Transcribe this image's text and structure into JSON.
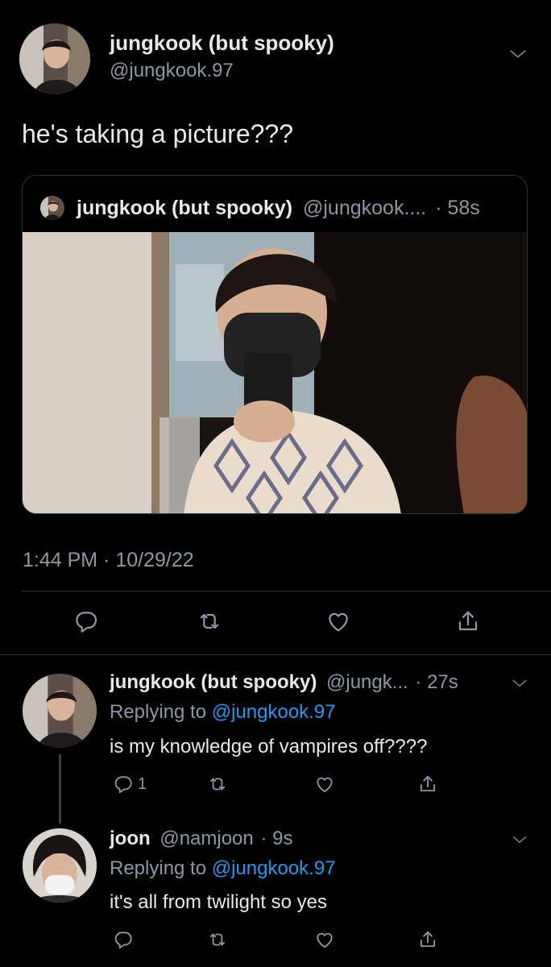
{
  "main_tweet": {
    "display_name": "jungkook (but spooky)",
    "handle": "@jungkook.97",
    "text": "he's taking a picture???",
    "timestamp": "1:44 PM · 10/29/22"
  },
  "quoted_tweet": {
    "display_name": "jungkook (but spooky)",
    "handle": "@jungkook....",
    "time": "· 58s"
  },
  "replies": [
    {
      "display_name": "jungkook (but spooky)",
      "handle": "@jungk...",
      "time": "· 27s",
      "replying_label": "Replying to",
      "replying_to": "@jungkook.97",
      "text": "is my knowledge of vampires off????",
      "reply_count": "1"
    },
    {
      "display_name": "joon",
      "handle": "@namjoon",
      "time": "· 9s",
      "replying_label": "Replying to",
      "replying_to": "@jungkook.97",
      "text": "it's all from twilight so yes",
      "reply_count": ""
    }
  ],
  "colors": {
    "background": "#000000",
    "text": "#e7e9ea",
    "muted": "#8b98a5",
    "link": "#1d9bf0",
    "divider": "#2f3336"
  }
}
